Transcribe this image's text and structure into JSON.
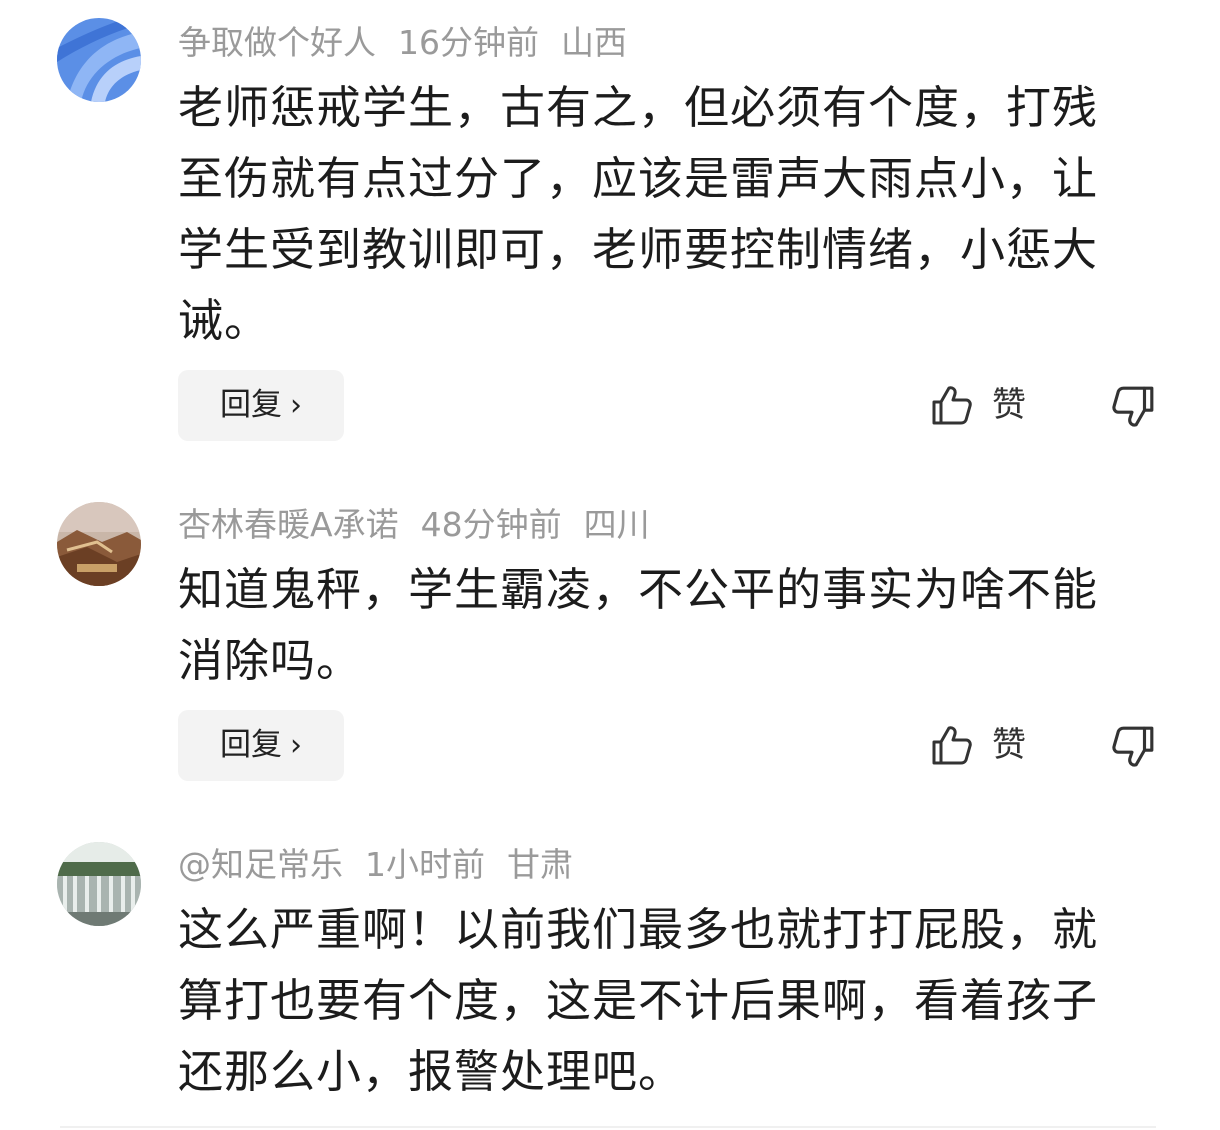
{
  "comments": [
    {
      "author": "争取做个好人",
      "time": "16分钟前",
      "location": "山西",
      "text": "老师惩戒学生，古有之，但必须有个度，打残至伤就有点过分了，应该是雷声大雨点小，让学生受到教训即可，老师要控制情绪，小惩大诫。",
      "reply_label": "回复",
      "like_label": "赞"
    },
    {
      "author": "杏林春暖A承诺",
      "time": "48分钟前",
      "location": "四川",
      "text": "知道鬼秤，学生霸凌，不公平的事实为啥不能消除吗。",
      "reply_label": "回复",
      "like_label": "赞"
    },
    {
      "author": "@知足常乐",
      "time": "1小时前",
      "location": "甘肃",
      "text": "这么严重啊！以前我们最多也就打打屁股，就算打也要有个度，这是不计后果啊，看着孩子还那么小，报警处理吧。"
    }
  ],
  "icons": {
    "thumb_up": "thumb-up-icon",
    "thumb_down": "thumb-down-icon",
    "chevron": "chevron-right-icon"
  }
}
